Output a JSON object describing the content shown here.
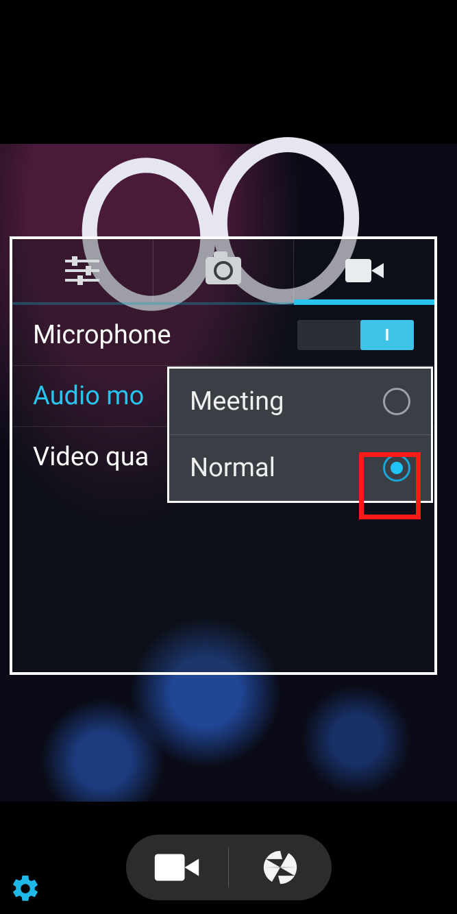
{
  "tabs": {
    "settings_icon": "sliders-icon",
    "photo_icon": "camera-icon",
    "video_icon": "video-icon",
    "active_index": 2
  },
  "settings": {
    "microphone": {
      "label": "Microphone",
      "value": "on",
      "toggle_on_glyph": "I"
    },
    "audio_mode": {
      "label": "Audio mo",
      "active": true
    },
    "video_quality": {
      "label": "Video qua"
    }
  },
  "audio_mode_popup": {
    "options": [
      {
        "label": "Meeting",
        "selected": false
      },
      {
        "label": "Normal",
        "selected": true
      }
    ],
    "highlighted_index": 1
  },
  "bottom_bar": {
    "settings_icon": "gear-icon",
    "record_icon": "video-icon",
    "shutter_icon": "shutter-icon"
  },
  "colors": {
    "accent": "#29c3ef",
    "highlight": "#ff1a1a"
  }
}
